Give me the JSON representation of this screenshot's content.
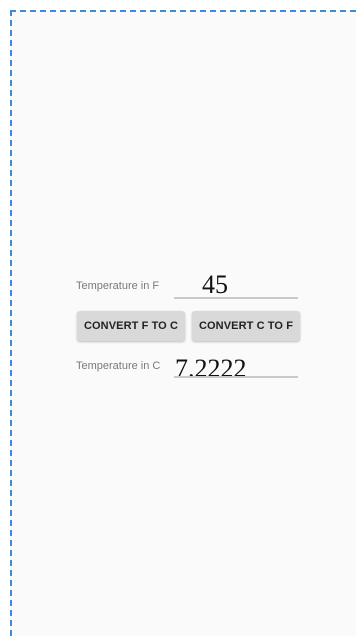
{
  "form": {
    "fahrenheit_label": "Temperature in F",
    "fahrenheit_value": "45",
    "celsius_label": "Temperature in C",
    "celsius_value": "7.2222"
  },
  "buttons": {
    "f_to_c_label": "CONVERT F TO C",
    "c_to_f_label": "CONVERT C TO F"
  },
  "colors": {
    "screen_background": "#fafafa",
    "button_background": "#d9d9d9",
    "border_dashed": "#3d8bd9"
  }
}
